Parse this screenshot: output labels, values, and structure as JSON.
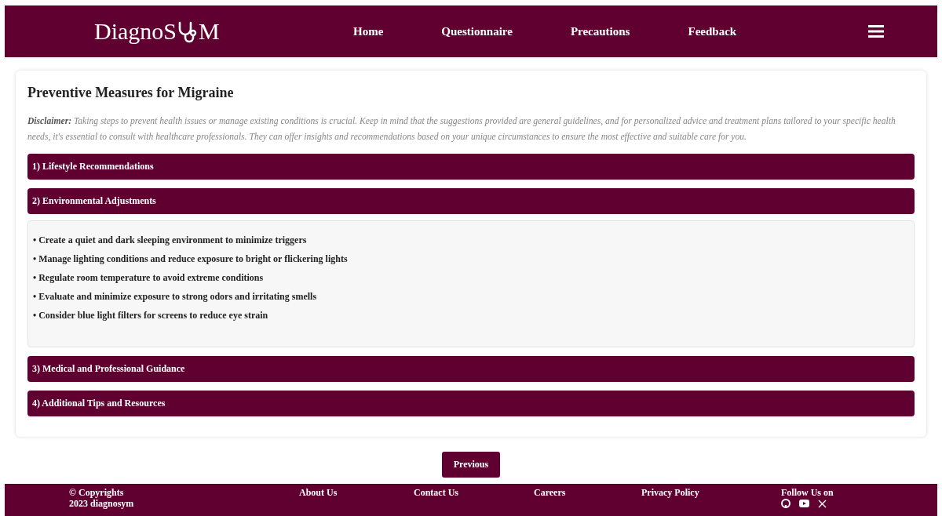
{
  "header": {
    "logo": {
      "before": "DiagnoS",
      "after": "M"
    },
    "nav": [
      {
        "label": "Home"
      },
      {
        "label": "Questionnaire"
      },
      {
        "label": "Precautions"
      },
      {
        "label": "Feedback"
      }
    ]
  },
  "main": {
    "title": "Preventive Measures for Migraine",
    "disclaimer": "**Disclaimer:** Taking steps to prevent health issues or manage existing conditions is crucial. Keep in mind that the suggestions provided are general guidelines, and for personalized advice and treatment plans tailored to your specific health needs, it's essential to consult with healthcare professionals. They can offer insights and recommendations based on your unique circumstances to ensure the most effective and suitable care for you.",
    "sections": [
      {
        "title": "1) Lifestyle Recommendations"
      },
      {
        "title": "2) Environmental Adjustments",
        "items": [
          "• Create a quiet and dark sleeping environment to minimize triggers",
          "• Manage lighting conditions and reduce exposure to bright or flickering lights",
          "• Regulate room temperature to avoid extreme conditions",
          "• Evaluate and minimize exposure to strong odors and irritating smells",
          "• Consider blue light filters for screens to reduce eye strain"
        ]
      },
      {
        "title": "3) Medical and Professional Guidance"
      },
      {
        "title": "4) Additional Tips and Resources"
      }
    ]
  },
  "previous_button": "Previous",
  "footer": {
    "copyright": [
      "© Copyrights",
      "2023 diagnosym"
    ],
    "links": [
      "About Us",
      "Contact Us",
      "Careers",
      "Privacy Policy"
    ],
    "follow": "Follow Us on",
    "social": [
      {
        "kind": "github"
      },
      {
        "kind": "youtube"
      },
      {
        "kind": "x"
      }
    ]
  }
}
